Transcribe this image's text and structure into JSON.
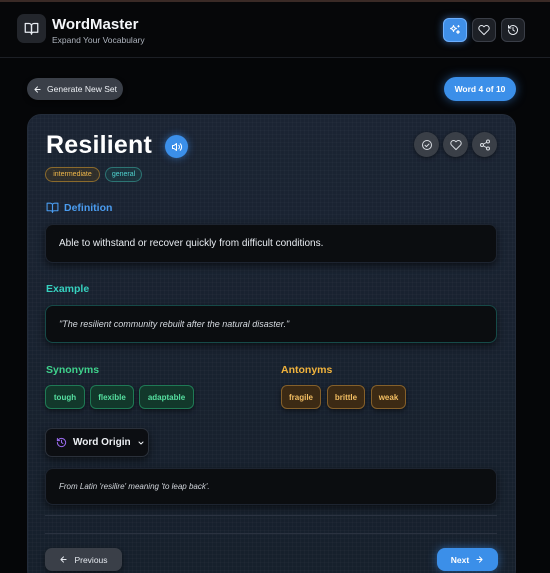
{
  "app": {
    "title": "WordMaster",
    "subtitle": "Expand Your Vocabulary",
    "logo_icon": "open-book-icon"
  },
  "header_actions": [
    {
      "icon": "sparkles-icon",
      "active": true
    },
    {
      "icon": "heart-icon",
      "active": false
    },
    {
      "icon": "history-icon",
      "active": false
    }
  ],
  "toolbar": {
    "generate_label": "Generate New Set",
    "counter_label": "Word 4 of 10"
  },
  "word": {
    "text": "Resilient",
    "level": "intermediate",
    "category": "general"
  },
  "definition": {
    "heading": "Definition",
    "text": "Able to withstand or recover quickly from difficult conditions."
  },
  "example": {
    "heading": "Example",
    "text": "\"The resilient community rebuilt after the natural disaster.\""
  },
  "synonyms": {
    "heading": "Synonyms",
    "items": [
      "tough",
      "flexible",
      "adaptable"
    ]
  },
  "antonyms": {
    "heading": "Antonyms",
    "items": [
      "fragile",
      "brittle",
      "weak"
    ]
  },
  "origin": {
    "toggle_label": "Word Origin",
    "text": "From Latin 'resilire' meaning 'to leap back'."
  },
  "nav": {
    "previous_label": "Previous",
    "next_label": "Next"
  },
  "colors": {
    "accent": "#3b8fe9",
    "example": "#36d1bf",
    "synonym": "#3fd28c",
    "antonym": "#f2b43c"
  }
}
